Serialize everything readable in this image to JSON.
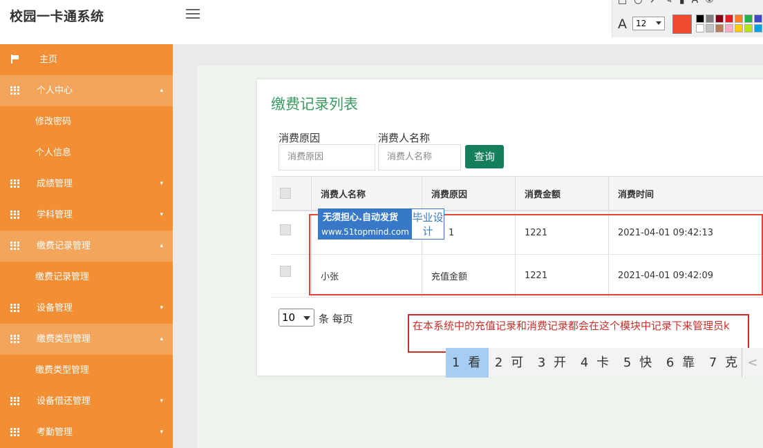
{
  "header": {
    "app_title": "校园一卡通系统"
  },
  "annotation_toolbar": {
    "font_size": "12",
    "font_icon_label": "A",
    "current_color": "#ef4a2b",
    "palette": [
      "#000000",
      "#7f7f7f",
      "#880015",
      "#ed1c24",
      "#ff7f27",
      "#22b14c",
      "#3f48cc",
      "#a349a4",
      "#ffffff",
      "#c3c3c3",
      "#b97a57",
      "#ffaec9",
      "#ffc90e",
      "#b5e61d",
      "#00a2e8",
      "#7092be"
    ]
  },
  "sidebar": {
    "items": [
      {
        "label": "主页",
        "icon": "flag-icon",
        "type": "top"
      },
      {
        "label": "个人中心",
        "icon": "grid-icon",
        "type": "group",
        "caret": "^",
        "open": true
      },
      {
        "label": "修改密码",
        "type": "sub"
      },
      {
        "label": "个人信息",
        "type": "sub"
      },
      {
        "label": "成绩管理",
        "icon": "grid-icon",
        "type": "group",
        "caret": "v"
      },
      {
        "label": "学科管理",
        "icon": "grid-icon",
        "type": "group",
        "caret": "v"
      },
      {
        "label": "缴费记录管理",
        "icon": "grid-icon",
        "type": "group",
        "caret": "^",
        "open": true
      },
      {
        "label": "缴费记录管理",
        "type": "sub"
      },
      {
        "label": "设备管理",
        "icon": "grid-icon",
        "type": "group",
        "caret": "v"
      },
      {
        "label": "缴费类型管理",
        "icon": "grid-icon",
        "type": "group",
        "caret": "^",
        "open": true
      },
      {
        "label": "缴费类型管理",
        "type": "sub"
      },
      {
        "label": "设备借还管理",
        "icon": "grid-icon",
        "type": "group",
        "caret": "v"
      },
      {
        "label": "考勤管理",
        "icon": "grid-icon",
        "type": "group",
        "caret": "v"
      }
    ]
  },
  "main": {
    "title": "缴费记录列表",
    "filters": {
      "reason_label": "消费原因",
      "reason_placeholder": "消费原因",
      "name_label": "消费人名称",
      "name_placeholder": "消费人名称",
      "query_button": "查询"
    },
    "table": {
      "columns": [
        "消费人名称",
        "消费原因",
        "消费金额",
        "消费时间"
      ],
      "rows": [
        {
          "name": "",
          "reason": "1",
          "amount": "1221",
          "time": "2021-04-01 09:42:13"
        },
        {
          "name": "小张",
          "reason": "充值金额",
          "amount": "1221",
          "time": "2021-04-01 09:42:09"
        }
      ]
    },
    "pagination": {
      "per_page": "10",
      "per_page_suffix": "条 每页"
    }
  },
  "watermark": {
    "line1": "无须担心.自动发货",
    "line2": "www.51topmind.com",
    "right": "毕业设计"
  },
  "note": {
    "text": "在本系统中的充值记录和消费记录都会在这个模块中记录下来管理员k"
  },
  "ime": {
    "candidates": [
      "1 看",
      "2 可",
      "3 开",
      "4 卡",
      "5 快",
      "6 靠",
      "7 克"
    ],
    "prev": "<"
  }
}
